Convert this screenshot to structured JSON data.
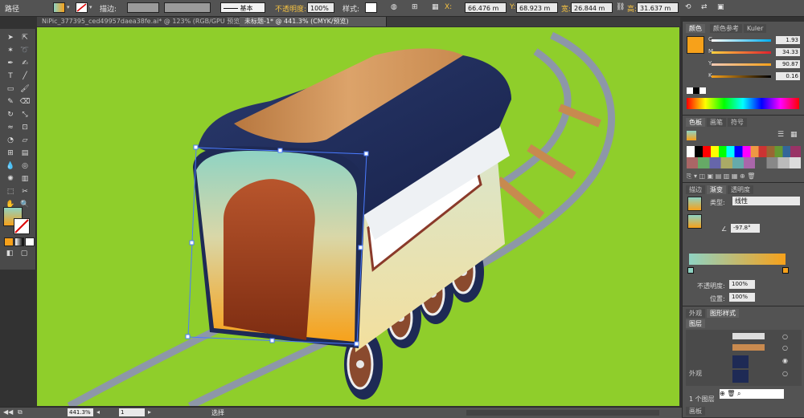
{
  "control_bar": {
    "object_type": "路径",
    "stroke_label": "描边:",
    "stroke_style": "基本",
    "opacity_label": "不透明度:",
    "opacity_value": "100%",
    "style_label": "样式:",
    "x_label": "X:",
    "x_value": "66.476 m",
    "y_label": "Y:",
    "y_value": "68.923 m",
    "w_label": "宽:",
    "w_value": "26.844 m",
    "h_label": "高:",
    "h_value": "31.637 m"
  },
  "tabs": [
    {
      "label": "NiPic_377395_ced49957daea38fe.ai* @ 123% (RGB/GPU 预览)"
    },
    {
      "label": "未标题-1* @ 441.3% (CMYK/预览)"
    }
  ],
  "status": {
    "zoom": "441.3%",
    "page": "1",
    "tool": "选择"
  },
  "color_panel": {
    "tabs": [
      "颜色",
      "颜色参考",
      "Kuler"
    ],
    "swatch_color": "#f7a11a",
    "c": {
      "label": "C",
      "value": "1.93",
      "unit": "%"
    },
    "m": {
      "label": "M",
      "value": "34.33",
      "unit": "%"
    },
    "y": {
      "label": "Y",
      "value": "90.87",
      "unit": "%"
    },
    "k": {
      "label": "K",
      "value": "0.16",
      "unit": "%"
    }
  },
  "swatches_panel": {
    "tabs": [
      "色板",
      "画笔",
      "符号"
    ]
  },
  "gradient_panel": {
    "tabs": [
      "描边",
      "渐变",
      "透明度"
    ],
    "type_label": "类型:",
    "type_value": "线性",
    "angle_value": "-97.8°",
    "opacity_label": "不透明度:",
    "opacity_value": "100%",
    "position_label": "位置:",
    "position_value": "100%",
    "start_color": "#8fd3c3",
    "end_color": "#f7a11a"
  },
  "appearance_panel": {
    "tabs": [
      "外观",
      "图形样式"
    ],
    "layers_tab": "图层",
    "appearance_tab": "外观",
    "layer_count": "1 个图层",
    "bottom_tab": "画板"
  },
  "colors": {
    "canvas_bg": "#8fce2b",
    "train_roof": "#1e2a55",
    "train_tan": "#c98a4f",
    "door": "#8d3c1c",
    "track": "#8d97a8",
    "sleeper": "#c78a4f"
  }
}
